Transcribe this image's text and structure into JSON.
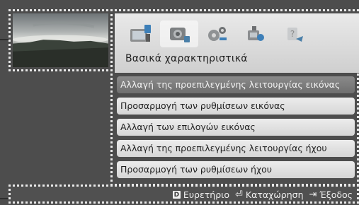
{
  "menu": {
    "section_title": "Βασικά χαρακτηριστικά",
    "tabs": [
      {
        "icon": "picture-icon"
      },
      {
        "icon": "sound-icon"
      },
      {
        "icon": "setup-icon"
      },
      {
        "icon": "support-icon"
      },
      {
        "icon": "help-icon"
      }
    ],
    "active_tab_index": 1,
    "items": [
      {
        "label": "Αλλαγή της προεπιλεγμένης λειτουργίας εικόνας",
        "selected": true
      },
      {
        "label": "Προσαρμογή των ρυθμίσεων εικόνας",
        "selected": false
      },
      {
        "label": "Αλλαγή των επιλογών εικόνας",
        "selected": false
      },
      {
        "label": "Αλλαγή της προεπιλεγμένης λειτουργίας ήχου",
        "selected": false
      },
      {
        "label": "Προσαρμογή των ρυθμίσεων ήχου",
        "selected": false
      }
    ]
  },
  "bottom_bar": {
    "index": {
      "key": "D",
      "label": "Ευρετήριο"
    },
    "enter": {
      "label": "Καταχώρηση"
    },
    "exit": {
      "label": "Έξοδος"
    }
  },
  "colors": {
    "background": "#4d4d4d",
    "item_bg": "#e2e2e2",
    "item_selected_bg": "#7b7b7b",
    "header_bg": "#dcdcdc",
    "dotted_outline": "#e8e8e8"
  }
}
